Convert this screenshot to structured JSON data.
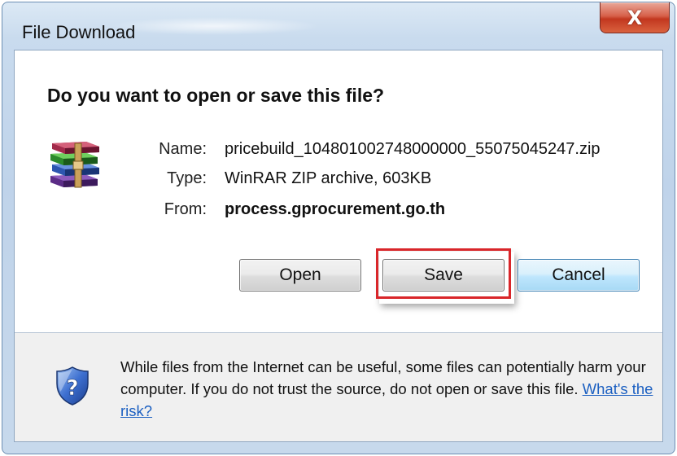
{
  "dialog": {
    "title": "File Download",
    "close_label": "X",
    "question": "Do you want to open or save this file?"
  },
  "file": {
    "icon": "winrar-archive-icon",
    "name_label": "Name:",
    "name": "pricebuild_104801002748000000_55075045247.zip",
    "type_label": "Type:",
    "type": "WinRAR ZIP archive, 603KB",
    "from_label": "From:",
    "from": "process.gprocurement.go.th"
  },
  "buttons": {
    "open": "Open",
    "save": "Save",
    "cancel": "Cancel"
  },
  "warning": {
    "icon": "shield-question-icon",
    "text": "While files from the Internet can be useful, some files can potentially harm your computer. If you do not trust the source, do not open or save this file. ",
    "link": "What's the risk?"
  },
  "colors": {
    "highlight": "#d9262a",
    "link": "#1b5fc1",
    "close_button": "#c2371f"
  }
}
